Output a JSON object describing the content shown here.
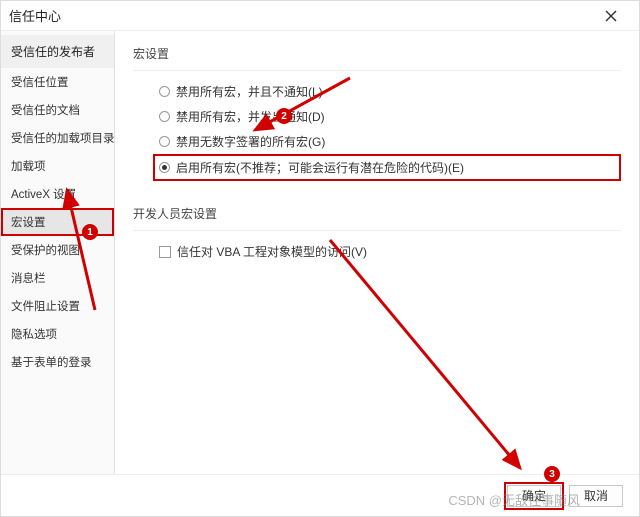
{
  "titlebar": {
    "title": "信任中心"
  },
  "sidebar": {
    "header": "受信任的发布者",
    "items": [
      {
        "label": "受信任位置"
      },
      {
        "label": "受信任的文档"
      },
      {
        "label": "受信任的加载项目录"
      },
      {
        "label": "加载项"
      },
      {
        "label": "ActiveX 设置"
      },
      {
        "label": "宏设置",
        "selected": true
      },
      {
        "label": "受保护的视图"
      },
      {
        "label": "消息栏"
      },
      {
        "label": "文件阻止设置"
      },
      {
        "label": "隐私选项"
      },
      {
        "label": "基于表单的登录"
      }
    ]
  },
  "main": {
    "group1_title": "宏设置",
    "radios": [
      {
        "label": "禁用所有宏，并且不通知(L)",
        "selected": false
      },
      {
        "label": "禁用所有宏，并发出通知(D)",
        "selected": false
      },
      {
        "label": "禁用无数字签署的所有宏(G)",
        "selected": false
      },
      {
        "label": "启用所有宏(不推荐；可能会运行有潜在危险的代码)(E)",
        "selected": true,
        "highlight": true
      }
    ],
    "group2_title": "开发人员宏设置",
    "checkbox": {
      "label": "信任对 VBA 工程对象模型的访问(V)",
      "checked": false
    }
  },
  "footer": {
    "ok": "确定",
    "cancel": "取消"
  },
  "badges": {
    "b1": "1",
    "b2": "2",
    "b3": "3"
  },
  "watermark": "CSDN @无敌往事随风"
}
